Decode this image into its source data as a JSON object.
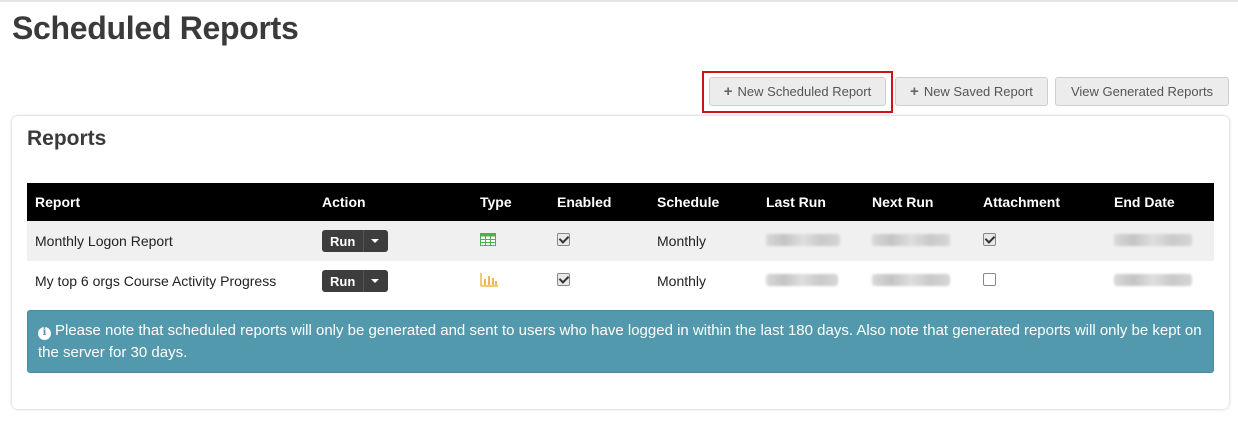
{
  "page": {
    "title": "Scheduled Reports"
  },
  "toolbar": {
    "new_scheduled_label": "New Scheduled Report",
    "new_saved_label": "New Saved Report",
    "view_generated_label": "View Generated Reports",
    "highlight_color": "#d0121a"
  },
  "panel": {
    "title": "Reports"
  },
  "table": {
    "headers": [
      "Report",
      "Action",
      "Type",
      "Enabled",
      "Schedule",
      "Last Run",
      "Next Run",
      "Attachment",
      "End Date"
    ],
    "rows": [
      {
        "report": "Monthly Logon Report",
        "action": "Run",
        "type_icon": "table-icon",
        "enabled": true,
        "schedule": "Monthly",
        "attachment": true
      },
      {
        "report": "My top 6 orgs Course Activity Progress",
        "action": "Run",
        "type_icon": "bar-chart-icon",
        "enabled": true,
        "schedule": "Monthly",
        "attachment": false
      }
    ]
  },
  "alert": {
    "text": "Please note that scheduled reports will only be generated and sent to users who have logged in within the last 180 days. Also note that generated reports will only be kept on the server for 30 days.",
    "icon": "info-icon",
    "color": "#5299ad"
  }
}
